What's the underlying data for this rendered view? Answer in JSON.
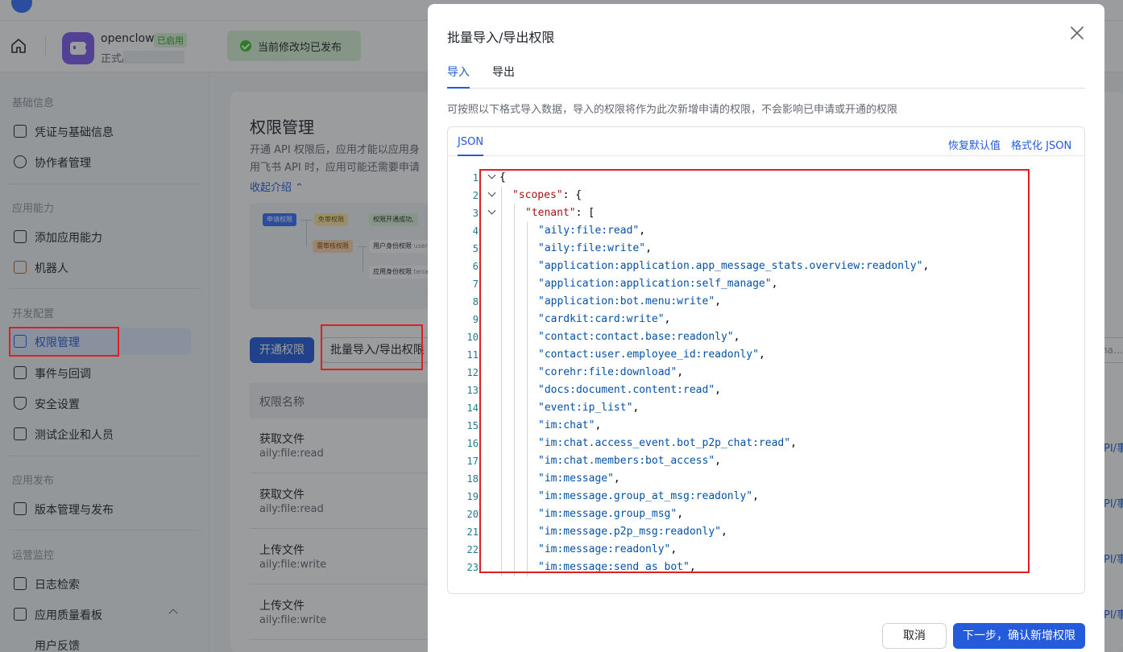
{
  "app": {
    "name": "openclow",
    "status_badge": "已启用",
    "env": "正式/",
    "publish_status": "当前修改均已发布"
  },
  "sidebar": {
    "groups": [
      {
        "title": "基础信息",
        "items": [
          {
            "label": "凭证与基础信息",
            "icon": "credential-icon"
          },
          {
            "label": "协作者管理",
            "icon": "user-add-icon"
          }
        ]
      },
      {
        "title": "应用能力",
        "items": [
          {
            "label": "添加应用能力",
            "icon": "grid-plus-icon"
          },
          {
            "label": "机器人",
            "icon": "robot-icon"
          }
        ]
      },
      {
        "title": "开发配置",
        "items": [
          {
            "label": "权限管理",
            "icon": "lock-icon",
            "active": true
          },
          {
            "label": "事件与回调",
            "icon": "event-icon"
          },
          {
            "label": "安全设置",
            "icon": "shield-icon"
          },
          {
            "label": "测试企业和人员",
            "icon": "code-icon"
          }
        ]
      },
      {
        "title": "应用发布",
        "items": [
          {
            "label": "版本管理与发布",
            "icon": "upload-icon"
          }
        ]
      },
      {
        "title": "运营监控",
        "items": [
          {
            "label": "日志检索",
            "icon": "log-search-icon"
          },
          {
            "label": "应用质量看板",
            "icon": "chart-icon"
          },
          {
            "label": "用户反馈",
            "icon": ""
          }
        ]
      }
    ]
  },
  "main": {
    "title": "权限管理",
    "desc_line1": "开通 API 权限后，应用才能以应用身",
    "desc_line2": "用飞书 API 时，应用可能还需要申请",
    "collapse_link": "收起介绍",
    "flow": {
      "apply": "申请权限",
      "free": "免审权限",
      "success": "权限开通成功,",
      "review": "需审核权限",
      "user_scope": "用户身份权限",
      "user_scope_key": "user_",
      "app_scope": "应用身份权限",
      "app_scope_key": "tenan"
    },
    "btn_open": "开通权限",
    "btn_batch": "批量导入/导出权限",
    "table_header": "权限名称",
    "rows": [
      {
        "name": "获取文件",
        "code": "aily:file:read"
      },
      {
        "name": "获取文件",
        "code": "aily:file:read"
      },
      {
        "name": "上传文件",
        "code": "aily:file:write"
      },
      {
        "name": "上传文件",
        "code": "aily:file:write"
      }
    ],
    "right_search_placeholder": "na...",
    "right_link": "PI/事"
  },
  "modal": {
    "title": "批量导入/导出权限",
    "tabs": [
      "导入",
      "导出"
    ],
    "active_tab": 0,
    "hint": "可按照以下格式导入数据，导入的权限将作为此次新增申请的权限，不会影响已申请或开通的权限",
    "editor_tab": "JSON",
    "restore_default": "恢复默认值",
    "format_json": "格式化 JSON",
    "code_lines": [
      {
        "n": "1",
        "fold": true,
        "indent": 0,
        "parts": [
          {
            "t": "{"
          }
        ]
      },
      {
        "n": "2",
        "fold": true,
        "indent": 1,
        "parts": [
          {
            "t": "\"scopes\"",
            "c": "key"
          },
          {
            "t": ": {"
          }
        ]
      },
      {
        "n": "3",
        "fold": true,
        "indent": 2,
        "parts": [
          {
            "t": "\"tenant\"",
            "c": "key"
          },
          {
            "t": ": ["
          }
        ]
      },
      {
        "n": "4",
        "indent": 3,
        "parts": [
          {
            "t": "\"aily:file:read\"",
            "c": "str"
          },
          {
            "t": ","
          }
        ]
      },
      {
        "n": "5",
        "indent": 3,
        "parts": [
          {
            "t": "\"aily:file:write\"",
            "c": "str"
          },
          {
            "t": ","
          }
        ]
      },
      {
        "n": "6",
        "indent": 3,
        "parts": [
          {
            "t": "\"application:application.app_message_stats.overview:readonly\"",
            "c": "str"
          },
          {
            "t": ","
          }
        ]
      },
      {
        "n": "7",
        "indent": 3,
        "parts": [
          {
            "t": "\"application:application:self_manage\"",
            "c": "str"
          },
          {
            "t": ","
          }
        ]
      },
      {
        "n": "8",
        "indent": 3,
        "parts": [
          {
            "t": "\"application:bot.menu:write\"",
            "c": "str"
          },
          {
            "t": ","
          }
        ]
      },
      {
        "n": "9",
        "indent": 3,
        "parts": [
          {
            "t": "\"cardkit:card:write\"",
            "c": "str"
          },
          {
            "t": ","
          }
        ]
      },
      {
        "n": "10",
        "indent": 3,
        "parts": [
          {
            "t": "\"contact:contact.base:readonly\"",
            "c": "str"
          },
          {
            "t": ","
          }
        ]
      },
      {
        "n": "11",
        "indent": 3,
        "parts": [
          {
            "t": "\"contact:user.employee_id:readonly\"",
            "c": "str"
          },
          {
            "t": ","
          }
        ]
      },
      {
        "n": "12",
        "indent": 3,
        "parts": [
          {
            "t": "\"corehr:file:download\"",
            "c": "str"
          },
          {
            "t": ","
          }
        ]
      },
      {
        "n": "13",
        "indent": 3,
        "parts": [
          {
            "t": "\"docs:document.content:read\"",
            "c": "str"
          },
          {
            "t": ","
          }
        ]
      },
      {
        "n": "14",
        "indent": 3,
        "parts": [
          {
            "t": "\"event:ip_list\"",
            "c": "str"
          },
          {
            "t": ","
          }
        ]
      },
      {
        "n": "15",
        "indent": 3,
        "parts": [
          {
            "t": "\"im:chat\"",
            "c": "str"
          },
          {
            "t": ","
          }
        ]
      },
      {
        "n": "16",
        "indent": 3,
        "parts": [
          {
            "t": "\"im:chat.access_event.bot_p2p_chat:read\"",
            "c": "str"
          },
          {
            "t": ","
          }
        ]
      },
      {
        "n": "17",
        "indent": 3,
        "parts": [
          {
            "t": "\"im:chat.members:bot_access\"",
            "c": "str"
          },
          {
            "t": ","
          }
        ]
      },
      {
        "n": "18",
        "indent": 3,
        "parts": [
          {
            "t": "\"im:message\"",
            "c": "str"
          },
          {
            "t": ","
          }
        ]
      },
      {
        "n": "19",
        "indent": 3,
        "parts": [
          {
            "t": "\"im:message.group_at_msg:readonly\"",
            "c": "str"
          },
          {
            "t": ","
          }
        ]
      },
      {
        "n": "20",
        "indent": 3,
        "parts": [
          {
            "t": "\"im:message.group_msg\"",
            "c": "str"
          },
          {
            "t": ","
          }
        ]
      },
      {
        "n": "21",
        "indent": 3,
        "parts": [
          {
            "t": "\"im:message.p2p_msg:readonly\"",
            "c": "str"
          },
          {
            "t": ","
          }
        ]
      },
      {
        "n": "22",
        "indent": 3,
        "parts": [
          {
            "t": "\"im:message:readonly\"",
            "c": "str"
          },
          {
            "t": ","
          }
        ]
      },
      {
        "n": "23",
        "indent": 3,
        "parts": [
          {
            "t": "\"im:message:send_as_bot\"",
            "c": "str"
          },
          {
            "t": ","
          }
        ]
      }
    ],
    "cancel": "取消",
    "next": "下一步，确认新增权限"
  },
  "colors": {
    "accent": "#245bdb",
    "highlight_box": "#e02020",
    "json_key": "#a31515",
    "json_string": "#0451a5"
  }
}
